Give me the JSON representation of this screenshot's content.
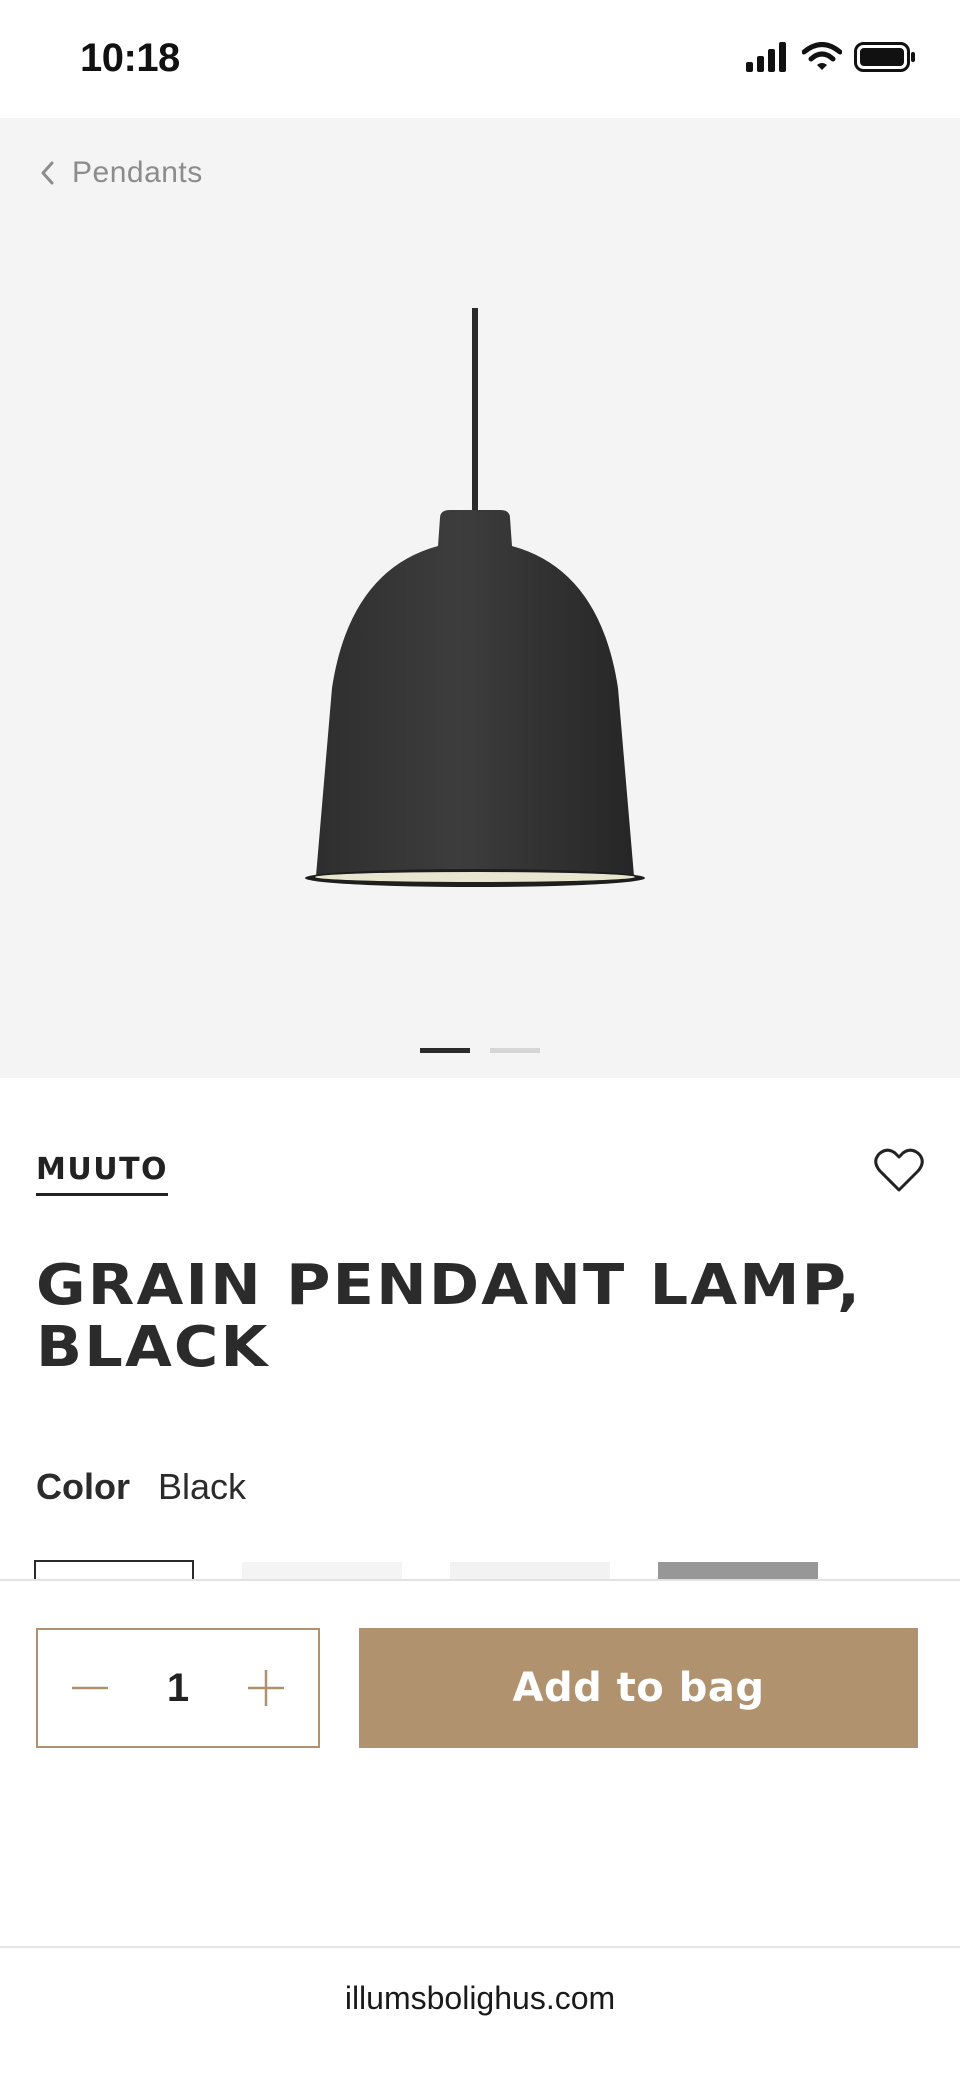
{
  "status_bar": {
    "time": "10:18"
  },
  "nav": {
    "back_label": "Pendants"
  },
  "gallery": {
    "image_count": 2,
    "active_index": 0
  },
  "product": {
    "brand": "MUUTO",
    "title": "GRAIN PENDANT LAMP, BLACK",
    "color_label": "Color",
    "color_value": "Black",
    "swatches": [
      {
        "name": "Black",
        "selected": true,
        "color": "#ffffff"
      },
      {
        "name": "White",
        "selected": false,
        "color": "#f4f4f4"
      },
      {
        "name": "Light grey",
        "selected": false,
        "color": "#f2f2f2"
      },
      {
        "name": "Grey",
        "selected": false,
        "color": "#979797"
      }
    ]
  },
  "cart": {
    "quantity": "1",
    "add_label": "Add to bag",
    "accent_color": "#b0936e"
  },
  "browser": {
    "url": "illumsbolighus.com"
  }
}
